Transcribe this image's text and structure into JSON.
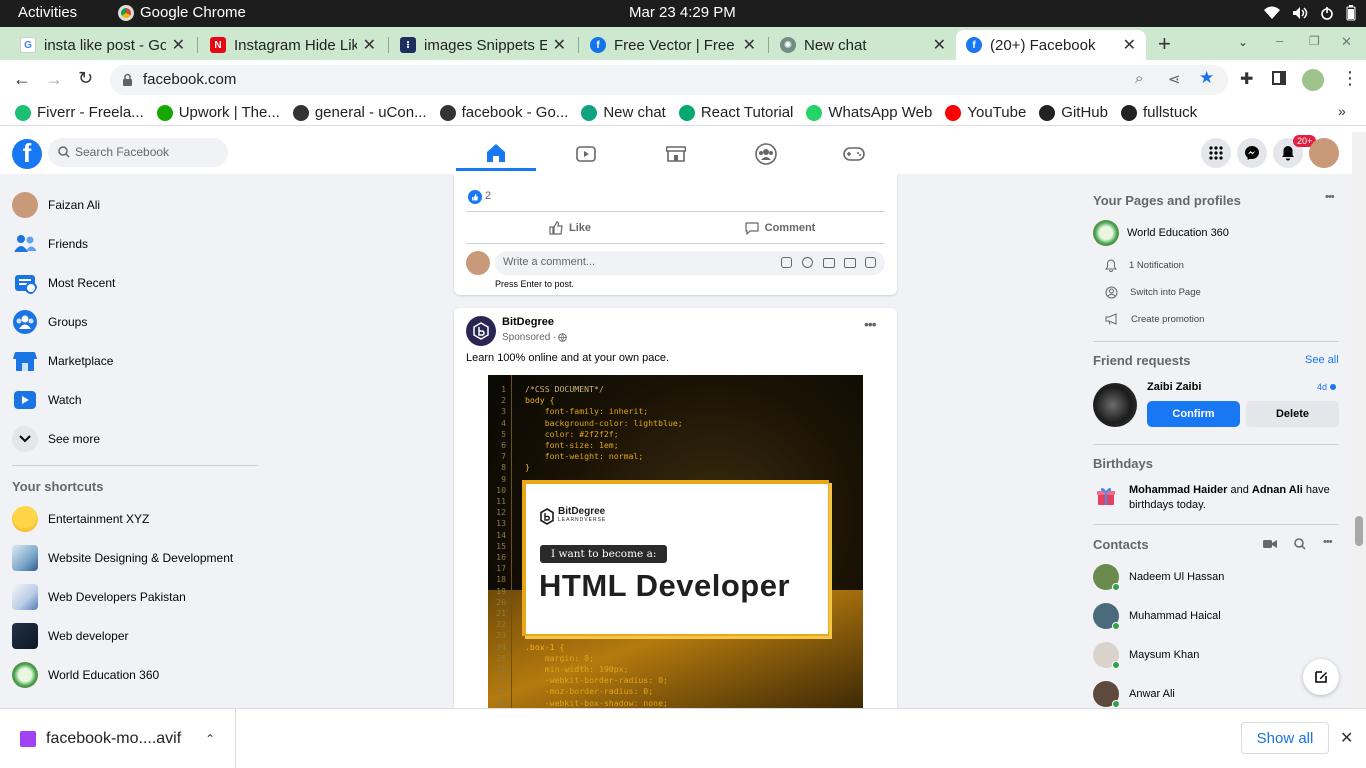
{
  "system_bar": {
    "activities": "Activities",
    "app_name": "Google Chrome",
    "clock": "Mar 23  4:29 PM"
  },
  "tabs": [
    {
      "title": "insta like post - Go",
      "icon": "google-icon"
    },
    {
      "title": "Instagram Hide Lik",
      "icon": "netflix-icon"
    },
    {
      "title": "images Snippets E",
      "icon": "snippets-icon"
    },
    {
      "title": "Free Vector | Free",
      "icon": "freepik-icon"
    },
    {
      "title": "New chat",
      "icon": "chatgpt-icon"
    },
    {
      "title": "(20+) Facebook",
      "icon": "facebook-icon"
    }
  ],
  "address_bar": {
    "url": "facebook.com"
  },
  "bookmarks": [
    {
      "label": "Fiverr - Freela...",
      "icon": "fiverr-icon",
      "color": "#1dbf73"
    },
    {
      "label": "Upwork | The...",
      "icon": "upwork-icon",
      "color": "#14a800"
    },
    {
      "label": "general - uCon...",
      "icon": "globe-icon",
      "color": "#333333"
    },
    {
      "label": "facebook - Go...",
      "icon": "globe-icon",
      "color": "#333333"
    },
    {
      "label": "New chat",
      "icon": "chatgpt-icon",
      "color": "#10a37f"
    },
    {
      "label": "React Tutorial",
      "icon": "w3schools-icon",
      "color": "#04aa6d"
    },
    {
      "label": "WhatsApp Web",
      "icon": "whatsapp-icon",
      "color": "#25d366"
    },
    {
      "label": "YouTube",
      "icon": "youtube-icon",
      "color": "#ff0000"
    },
    {
      "label": "GitHub",
      "icon": "github-icon",
      "color": "#222222"
    },
    {
      "label": "fullstuck",
      "icon": "github-icon",
      "color": "#222222"
    }
  ],
  "fb_header": {
    "search_placeholder": "Search Facebook",
    "notification_badge": "20+"
  },
  "left_nav": {
    "items": [
      {
        "label": "Faizan Ali",
        "icon": "profile-avatar"
      },
      {
        "label": "Friends",
        "icon": "friends-icon"
      },
      {
        "label": "Most Recent",
        "icon": "most-recent-icon"
      },
      {
        "label": "Groups",
        "icon": "groups-icon"
      },
      {
        "label": "Marketplace",
        "icon": "marketplace-icon"
      },
      {
        "label": "Watch",
        "icon": "watch-icon"
      },
      {
        "label": "See more",
        "icon": "chevron-down-icon"
      }
    ],
    "shortcuts_title": "Your shortcuts",
    "shortcuts": [
      {
        "label": "Entertainment XYZ"
      },
      {
        "label": "Website Designing & Development"
      },
      {
        "label": "Web Developers Pakistan"
      },
      {
        "label": "Web developer"
      },
      {
        "label": "World Education 360"
      }
    ]
  },
  "post1": {
    "reaction_count": "2",
    "like_label": "Like",
    "comment_label": "Comment",
    "comment_placeholder": "Write a comment...",
    "hint": "Press Enter to post."
  },
  "post2": {
    "author": "BitDegree",
    "meta": "Sponsored · ",
    "text": "Learn 100% online and at your own pace.",
    "ad": {
      "brand": "BitDegree",
      "brand_sub": "LEARNDVERSE",
      "tag": "I want to become a:",
      "headline": "HTML Developer"
    },
    "code_lines": [
      {
        "n": "1",
        "t": "/*CSS DOCUMENT*/"
      },
      {
        "n": "2",
        "t": "body {"
      },
      {
        "n": "3",
        "t": "    font-family: inherit;"
      },
      {
        "n": "4",
        "t": "    background-color: lightblue;"
      },
      {
        "n": "5",
        "t": "    color: #2f2f2f;"
      },
      {
        "n": "6",
        "t": "    font-size: 1em;"
      },
      {
        "n": "7",
        "t": "    font-weight: normal;"
      },
      {
        "n": "8",
        "t": "}"
      },
      {
        "n": "9",
        "t": ""
      },
      {
        "n": "10",
        "t": ""
      },
      {
        "n": "11",
        "t": ""
      },
      {
        "n": "12",
        "t": ""
      },
      {
        "n": "13",
        "t": ""
      },
      {
        "n": "14",
        "t": ""
      },
      {
        "n": "15",
        "t": ""
      },
      {
        "n": "16",
        "t": ""
      },
      {
        "n": "17",
        "t": ""
      },
      {
        "n": "18",
        "t": ""
      },
      {
        "n": "19",
        "t": ""
      },
      {
        "n": "20",
        "t": ""
      },
      {
        "n": "21",
        "t": ""
      },
      {
        "n": "22",
        "t": ""
      },
      {
        "n": "23",
        "t": ""
      },
      {
        "n": "24",
        "t": ".box-1 {"
      },
      {
        "n": "25",
        "t": "    margin: 0;"
      },
      {
        "n": "26",
        "t": "    min-width: 190px;"
      },
      {
        "n": "27",
        "t": "    -webkit-border-radius: 0;"
      },
      {
        "n": "28",
        "t": "    -moz-border-radius: 0;"
      },
      {
        "n": "29",
        "t": "    -webkit-box-shadow: none;"
      }
    ]
  },
  "right_col": {
    "pages_title": "Your Pages and profiles",
    "page_name": "World Education 360",
    "page_actions": [
      "1 Notification",
      "Switch into Page",
      "Create promotion"
    ],
    "friend_requests_title": "Friend requests",
    "see_all": "See all",
    "request": {
      "name": "Zaibi Zaibi",
      "age": "4d",
      "confirm": "Confirm",
      "delete": "Delete"
    },
    "birthdays_title": "Birthdays",
    "birthday": {
      "name1": "Mohammad Haider",
      "and": " and ",
      "name2": "Adnan Ali",
      "rest": " have birthdays today."
    },
    "contacts_title": "Contacts",
    "contacts": [
      "Nadeem Ul Hassan",
      "Muhammad Haical",
      "Maysum Khan",
      "Anwar Ali"
    ]
  },
  "download_bar": {
    "file": "facebook-mo....avif",
    "show_all": "Show all"
  },
  "colors": {
    "fb_blue": "#1877f2",
    "tab_strip": "#cde8cf",
    "page_bg": "#f0f2f5"
  }
}
